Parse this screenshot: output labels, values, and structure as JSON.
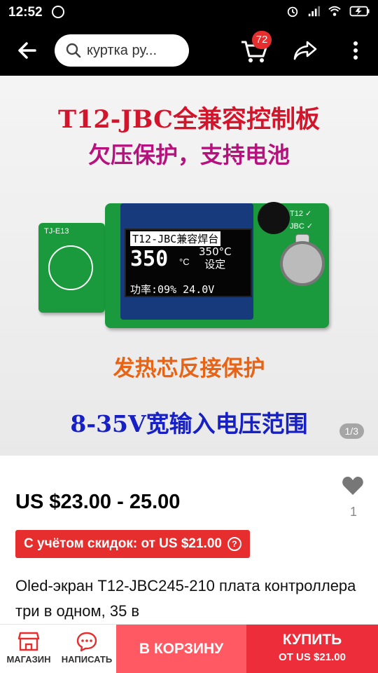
{
  "status_bar": {
    "time": "12:52",
    "icons": [
      "alarm-icon",
      "signal-icon",
      "wifi-icon",
      "battery-icon"
    ]
  },
  "app_bar": {
    "search_text": "куртка ру...",
    "cart_count": "72"
  },
  "product_image": {
    "line1": "T12-JBC全兼容控制板",
    "line2": "欠压保护，支持电池",
    "line3": "发热芯反接保护",
    "line4": "8-35V宽输入电压范围",
    "oled_row1": "T12-JBC兼容焊台",
    "oled_temp": "350",
    "oled_unit": "°C",
    "oled_set_temp": "350°C",
    "oled_set_label": "设定",
    "oled_row3": "功率:09%  24.0V",
    "board_tag": "TJ-E13",
    "board_t12": "T12 ✓",
    "board_jbc": "JBC ✓",
    "counter": "1/3"
  },
  "product": {
    "price": "US $23.00 - 25.00",
    "discount": "С учётом скидок: от US $21.00",
    "title": "Oled-экран T12-JBC245-210 плата контроллера три в одном, 35 в",
    "favorites": "1"
  },
  "bottom_bar": {
    "shop_label": "МАГАЗИН",
    "message_label": "НАПИСАТЬ",
    "add_to_cart": "В КОРЗИНУ",
    "buy_label": "КУПИТЬ",
    "buy_price": "ОТ US $21.00"
  },
  "colors": {
    "accent_red": "#e62e2e",
    "cart_button": "#ff5a63",
    "buy_button": "#ee2d3a"
  }
}
